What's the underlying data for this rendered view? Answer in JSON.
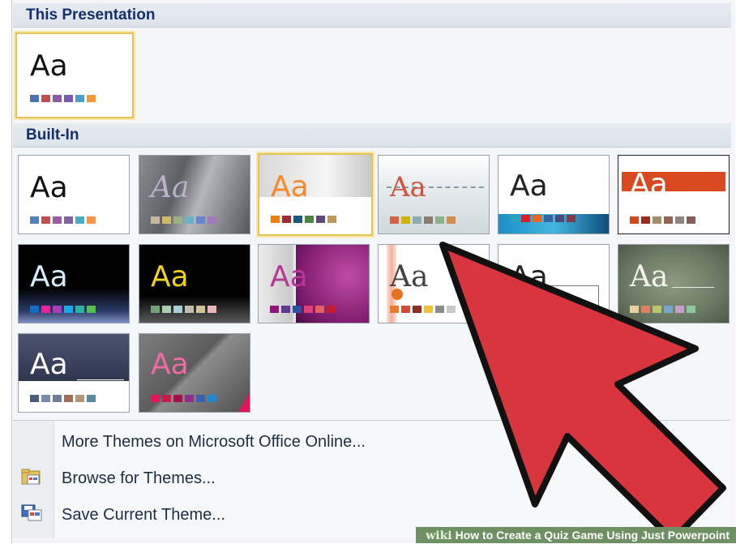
{
  "sections": {
    "this_presentation": "This Presentation",
    "built_in": "Built-In"
  },
  "thumb_text": "Aa",
  "menu": {
    "more_themes": "More Themes on Microsoft Office Online...",
    "browse": "Browse for Themes...",
    "save": "Save Current Theme..."
  },
  "watermark": {
    "wiki": "wiki",
    "caption": "How to Create a Quiz Game Using Just Powerpoint"
  },
  "colors": {
    "header_text": "#14306b",
    "selection": "#e7c25a",
    "arrow_fill": "#d9353f",
    "arrow_stroke": "#111111"
  },
  "icons": [
    "folder-icon",
    "save-theme-icon",
    "arrow-cursor-icon"
  ]
}
